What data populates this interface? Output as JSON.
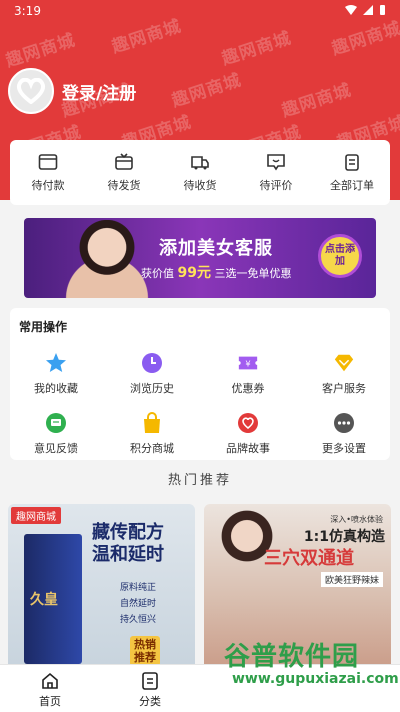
{
  "status_bar": {
    "time": "3:19"
  },
  "watermark_text": "趣网商城",
  "profile": {
    "login_label": "登录/注册"
  },
  "orders": [
    {
      "label": "待付款",
      "icon": "wallet-icon"
    },
    {
      "label": "待发货",
      "icon": "box-icon"
    },
    {
      "label": "待收货",
      "icon": "truck-icon"
    },
    {
      "label": "待评价",
      "icon": "comment-icon"
    },
    {
      "label": "全部订单",
      "icon": "clipboard-icon"
    }
  ],
  "banner": {
    "title": "添加美女客服",
    "sub_prefix": "获价值",
    "sub_price": "99元",
    "sub_suffix": "三选一免单优惠",
    "button": "点击添加"
  },
  "operations": {
    "title": "常用操作",
    "items": [
      {
        "label": "我的收藏",
        "icon": "star-icon",
        "color": "#3aa0f0"
      },
      {
        "label": "浏览历史",
        "icon": "clock-icon",
        "color": "#8a5cf0"
      },
      {
        "label": "优惠券",
        "icon": "coupon-icon",
        "color": "#a25cf0"
      },
      {
        "label": "客户服务",
        "icon": "diamond-icon",
        "color": "#f5b800"
      },
      {
        "label": "意见反馈",
        "icon": "feedback-icon",
        "color": "#2fb04f"
      },
      {
        "label": "积分商城",
        "icon": "shopping-bag-icon",
        "color": "#f5b800"
      },
      {
        "label": "品牌故事",
        "icon": "heart-icon",
        "color": "#e23a3a"
      },
      {
        "label": "更多设置",
        "icon": "more-icon",
        "color": "#555555"
      }
    ]
  },
  "hot_title": "热门推荐",
  "products": [
    {
      "tag": "趣网商城",
      "box_text": "久皇",
      "headline_1": "藏传配方",
      "headline_2": "温和延时",
      "points": [
        "原料纯正",
        "自然延时",
        "持久恒兴"
      ],
      "hot_label_1": "热销",
      "hot_label_2": "推荐"
    },
    {
      "top_note": "深入•喷水体验",
      "big_note": "1:1仿真构造",
      "main": "三穴双通道",
      "sub": "欧美狂野辣妹"
    }
  ],
  "site_watermark": {
    "line1": "谷普软件园",
    "line2": "www.gupuxiazai.com"
  },
  "tabbar": [
    {
      "label": "首页",
      "icon": "home-icon"
    },
    {
      "label": "分类",
      "icon": "category-icon"
    }
  ]
}
